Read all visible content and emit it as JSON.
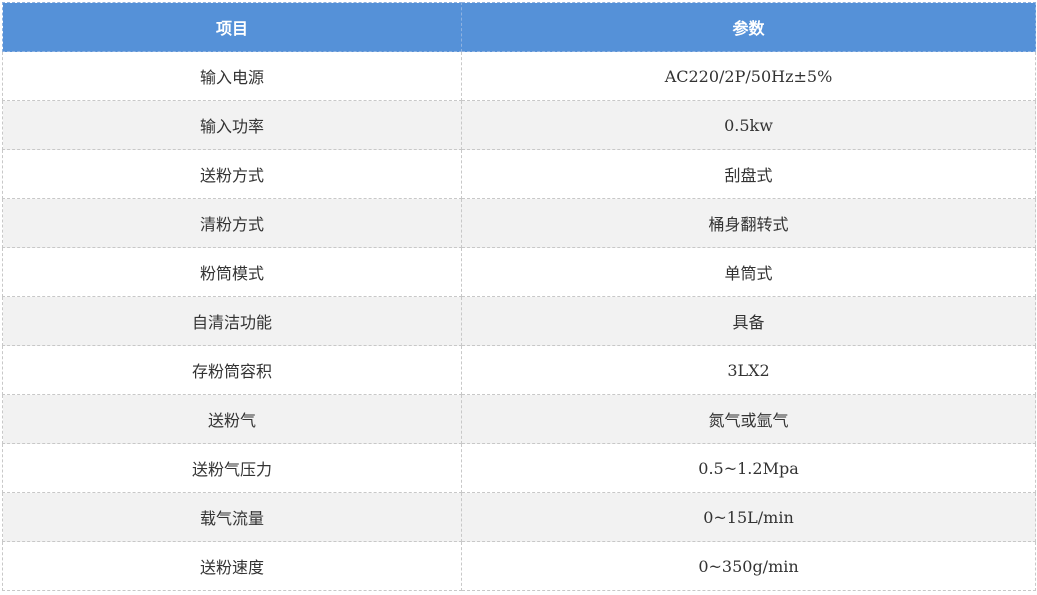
{
  "table": {
    "headers": [
      "项目",
      "参数"
    ],
    "rows": [
      [
        "输入电源",
        "AC220/2P/50Hz±5%"
      ],
      [
        "输入功率",
        "0.5kw"
      ],
      [
        "送粉方式",
        "刮盘式"
      ],
      [
        "清粉方式",
        "桶身翻转式"
      ],
      [
        "粉筒模式",
        "单筒式"
      ],
      [
        "自清洁功能",
        "具备"
      ],
      [
        "存粉筒容积",
        "3LX2"
      ],
      [
        "送粉气",
        "氮气或氩气"
      ],
      [
        "送粉气压力",
        "0.5~1.2Mpa"
      ],
      [
        "载气流量",
        "0~15L/min"
      ],
      [
        "送粉速度",
        "0~350g/min"
      ]
    ]
  },
  "colors": {
    "header_bg": "#5591d8",
    "header_text": "#ffffff",
    "row_alt_bg": "#f2f2f2",
    "body_text": "#333333"
  }
}
